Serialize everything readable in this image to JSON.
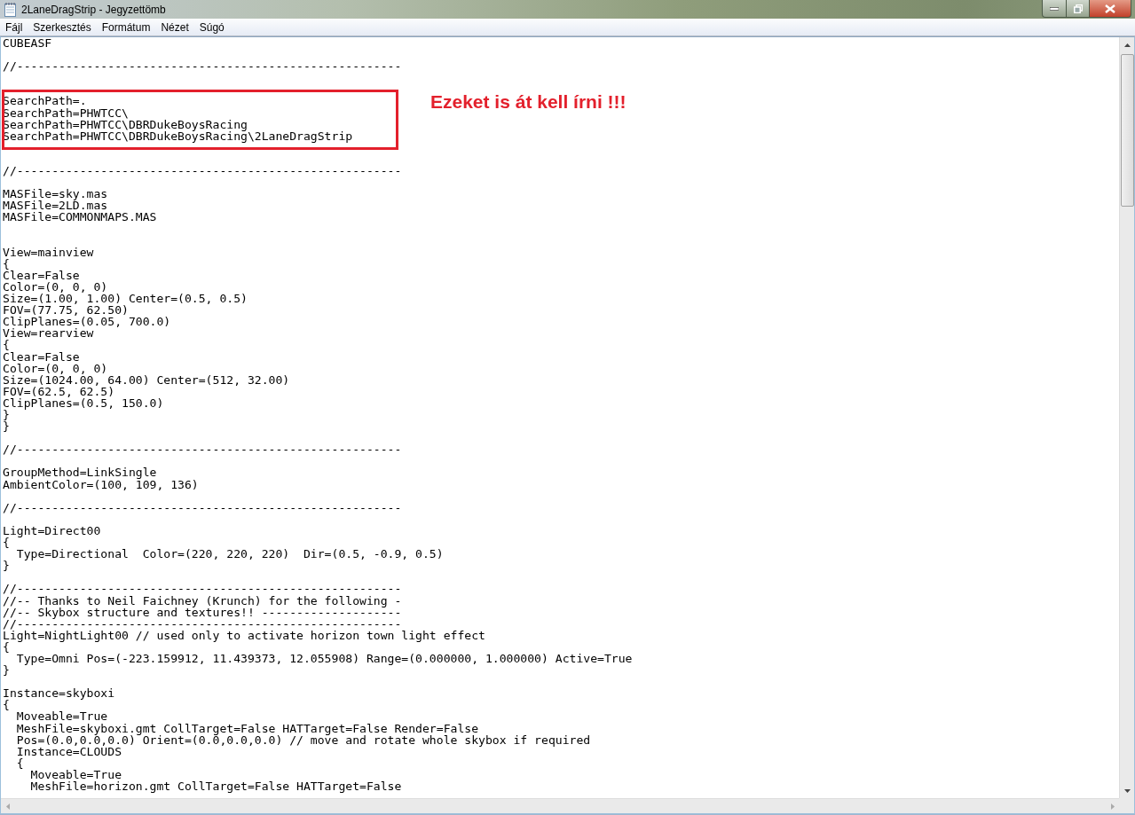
{
  "window": {
    "title": "2LaneDragStrip - Jegyzettömb"
  },
  "menu": [
    "Fájl",
    "Szerkesztés",
    "Formátum",
    "Nézet",
    "Súgó"
  ],
  "lines": [
    {
      "kind": "text",
      "text": "CUBEASF"
    },
    {
      "kind": "blank"
    },
    {
      "kind": "text",
      "text": "//-------------------------------------------------------"
    },
    {
      "kind": "blank"
    },
    {
      "kind": "blank"
    },
    {
      "kind": "text",
      "text": "SearchPath=.",
      "highlighted": true
    },
    {
      "kind": "text",
      "text": "SearchPath=PHWTCC\\",
      "highlighted": true
    },
    {
      "kind": "text",
      "text": "SearchPath=PHWTCC\\DBRDukeBoysRacing",
      "highlighted": true
    },
    {
      "kind": "text",
      "text": "SearchPath=PHWTCC\\DBRDukeBoysRacing\\2LaneDragStrip",
      "highlighted": true
    },
    {
      "kind": "blank"
    },
    {
      "kind": "blank"
    },
    {
      "kind": "text",
      "text": "//-------------------------------------------------------"
    },
    {
      "kind": "blank"
    },
    {
      "kind": "text",
      "text": "MASFile=sky.mas"
    },
    {
      "kind": "text",
      "text": "MASFile=2LD.mas"
    },
    {
      "kind": "text",
      "text": "MASFile=COMMONMAPS.MAS"
    },
    {
      "kind": "blank"
    },
    {
      "kind": "blank"
    },
    {
      "kind": "text",
      "text": "View=mainview"
    },
    {
      "kind": "text",
      "text": "{"
    },
    {
      "kind": "text",
      "text": "Clear=False"
    },
    {
      "kind": "text",
      "text": "Color=(0, 0, 0)"
    },
    {
      "kind": "text",
      "text": "Size=(1.00, 1.00) Center=(0.5, 0.5)"
    },
    {
      "kind": "text",
      "text": "FOV=(77.75, 62.50)"
    },
    {
      "kind": "text",
      "text": "ClipPlanes=(0.05, 700.0)"
    },
    {
      "kind": "text",
      "text": "View=rearview"
    },
    {
      "kind": "text",
      "text": "{"
    },
    {
      "kind": "text",
      "text": "Clear=False"
    },
    {
      "kind": "text",
      "text": "Color=(0, 0, 0)"
    },
    {
      "kind": "text",
      "text": "Size=(1024.00, 64.00) Center=(512, 32.00)"
    },
    {
      "kind": "text",
      "text": "FOV=(62.5, 62.5)"
    },
    {
      "kind": "text",
      "text": "ClipPlanes=(0.5, 150.0)"
    },
    {
      "kind": "text",
      "text": "}"
    },
    {
      "kind": "text",
      "text": "}"
    },
    {
      "kind": "blank"
    },
    {
      "kind": "text",
      "text": "//-------------------------------------------------------"
    },
    {
      "kind": "blank"
    },
    {
      "kind": "text",
      "text": "GroupMethod=LinkSingle"
    },
    {
      "kind": "text",
      "text": "AmbientColor=(100, 109, 136)"
    },
    {
      "kind": "blank"
    },
    {
      "kind": "text",
      "text": "//-------------------------------------------------------"
    },
    {
      "kind": "blank"
    },
    {
      "kind": "text",
      "text": "Light=Direct00"
    },
    {
      "kind": "text",
      "text": "{"
    },
    {
      "kind": "text",
      "text": "  Type=Directional  Color=(220, 220, 220)  Dir=(0.5, -0.9, 0.5)"
    },
    {
      "kind": "text",
      "text": "}"
    },
    {
      "kind": "blank"
    },
    {
      "kind": "text",
      "text": "//-------------------------------------------------------"
    },
    {
      "kind": "text",
      "text": "//-- Thanks to Neil Faichney (Krunch) for the following -"
    },
    {
      "kind": "text",
      "text": "//-- Skybox structure and textures!! --------------------"
    },
    {
      "kind": "text",
      "text": "//-------------------------------------------------------"
    },
    {
      "kind": "text",
      "text": "Light=NightLight00 // used only to activate horizon town light effect"
    },
    {
      "kind": "text",
      "text": "{"
    },
    {
      "kind": "text",
      "text": "  Type=Omni Pos=(-223.159912, 11.439373, 12.055908) Range=(0.000000, 1.000000) Active=True"
    },
    {
      "kind": "text",
      "text": "}"
    },
    {
      "kind": "blank"
    },
    {
      "kind": "text",
      "text": "Instance=skyboxi"
    },
    {
      "kind": "text",
      "text": "{"
    },
    {
      "kind": "text",
      "text": "  Moveable=True"
    },
    {
      "kind": "text",
      "text": "  MeshFile=skyboxi.gmt CollTarget=False HATTarget=False Render=False"
    },
    {
      "kind": "text",
      "text": "  Pos=(0.0,0.0,0.0) Orient=(0.0,0.0,0.0) // move and rotate whole skybox if required"
    },
    {
      "kind": "text",
      "text": "  Instance=CLOUDS"
    },
    {
      "kind": "text",
      "text": "  {"
    },
    {
      "kind": "text",
      "text": "    Moveable=True"
    },
    {
      "kind": "text",
      "text": "    MeshFile=horizon.gmt CollTarget=False HATTarget=False"
    }
  ],
  "annotation": {
    "text": "Ezeket is át kell írni !!!"
  }
}
